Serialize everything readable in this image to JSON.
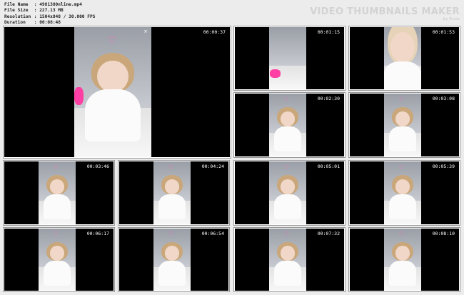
{
  "header": {
    "rows": [
      {
        "key": "File Name",
        "value": "4981380nline.mp4"
      },
      {
        "key": "File Size",
        "value": "227.13 MB"
      },
      {
        "key": "Resolution",
        "value": "1504x848 / 30.000 FPS"
      },
      {
        "key": "Duration",
        "value": "00:08:48"
      }
    ],
    "separator": ":"
  },
  "brand": {
    "title": "VIDEO THUMBNAILS MAKER",
    "subtitle": "by Ecvie"
  },
  "close_glyph": "×",
  "thumbnails": [
    {
      "timestamp": "00:00:37",
      "variant": "hero"
    },
    {
      "timestamp": "00:01:15",
      "variant": "room"
    },
    {
      "timestamp": "00:01:53",
      "variant": "closeup"
    },
    {
      "timestamp": "00:02:30",
      "variant": "girl"
    },
    {
      "timestamp": "00:03:08",
      "variant": "girl"
    },
    {
      "timestamp": "00:03:46",
      "variant": "girl"
    },
    {
      "timestamp": "00:04:24",
      "variant": "girl"
    },
    {
      "timestamp": "00:05:01",
      "variant": "girl"
    },
    {
      "timestamp": "00:05:39",
      "variant": "leaning"
    },
    {
      "timestamp": "00:06:17",
      "variant": "girl"
    },
    {
      "timestamp": "00:06:54",
      "variant": "girl"
    },
    {
      "timestamp": "00:07:32",
      "variant": "girl"
    },
    {
      "timestamp": "00:08:10",
      "variant": "girl"
    }
  ]
}
